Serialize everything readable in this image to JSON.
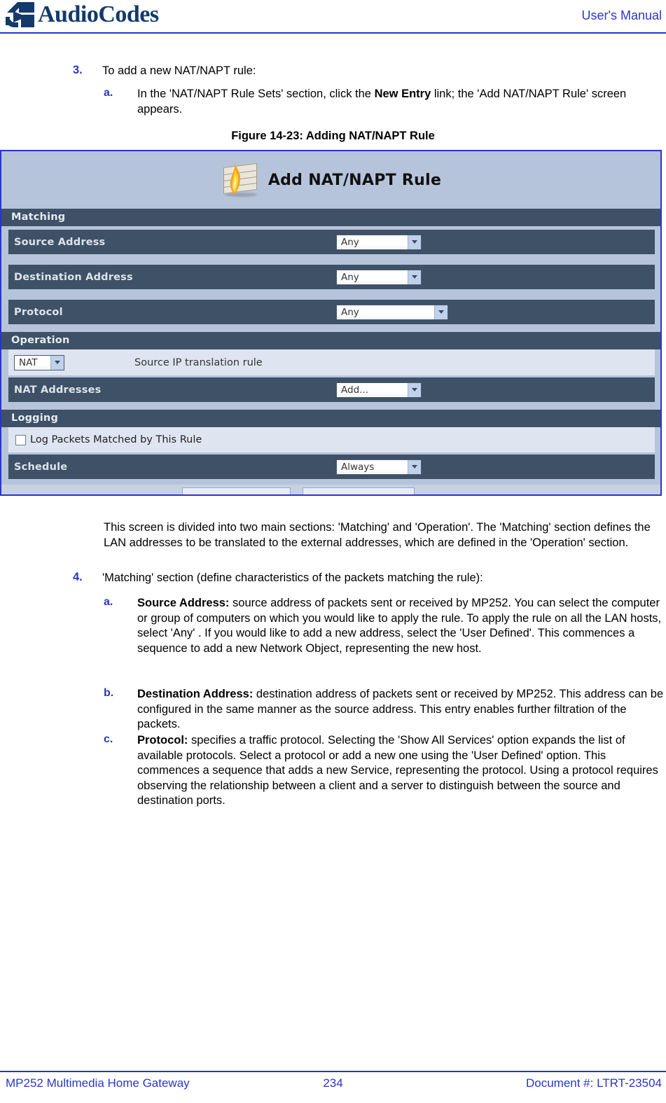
{
  "header": {
    "logo_text": "AudioCodes",
    "logo_icon": "audiocodes-logo-icon",
    "manual_label": "User's Manual"
  },
  "steps": {
    "step3_marker": "3.",
    "step3_text": "To add a new NAT/NAPT rule:",
    "step3a_marker": "a.",
    "step3a_text_part1": "In the 'NAT/NAPT Rule Sets' section, click the ",
    "step3a_bold": "New Entry",
    "step3a_text_part2": " link; the 'Add NAT/NAPT Rule' screen appears."
  },
  "figure": {
    "caption": "Figure 14-23: Adding NAT/NAPT Rule"
  },
  "screenshot": {
    "icon": "firewall-brick-flame-icon",
    "title": "Add NAT/NAPT Rule",
    "sections": [
      {
        "name": "Matching"
      },
      {
        "name": "Operation"
      },
      {
        "name": "Logging"
      }
    ],
    "matching_rows": [
      {
        "label": "Source Address",
        "value": "Any"
      },
      {
        "label": "Destination Address",
        "value": "Any"
      },
      {
        "label": "Protocol",
        "value": "Any"
      }
    ],
    "operation": {
      "select_value": "NAT",
      "description": "Source IP translation rule",
      "nat_addresses_label": "NAT Addresses",
      "nat_addresses_value": "Add..."
    },
    "logging": {
      "checkbox_label": "Log Packets Matched by This Rule",
      "checked": false
    },
    "schedule": {
      "label": "Schedule",
      "value": "Always"
    }
  },
  "body": {
    "para1": "This screen is divided into two main sections: 'Matching' and 'Operation'. The 'Matching' section defines the LAN addresses to be translated to the external addresses, which are defined in the 'Operation' section.",
    "step4_marker": "4.",
    "step4_text": "'Matching' section (define characteristics of the packets matching the rule):",
    "items": [
      {
        "marker": "a.",
        "bold": "Source Address:",
        "text": " source address of packets sent or received by MP252. You can select the computer or group of computers on which you would like to apply the rule. To apply the rule on all the LAN hosts, select 'Any' . If you would like to add a new address, select the 'User Defined'. This commences a sequence to add a new Network Object, representing the new host."
      },
      {
        "marker": "b.",
        "bold": "Destination Address:",
        "text": " destination address of packets sent or received by MP252. This address can be configured in the same manner as the source address. This entry enables further filtration of the packets."
      },
      {
        "marker": "c.",
        "bold": "Protocol:",
        "text": " specifies a traffic protocol. Selecting the 'Show All Services' option expands the list of available protocols. Select a protocol or add a new one using the 'User Defined' option. This commences a sequence that adds a new Service, representing the protocol. Using a protocol requires observing the relationship between a client and a server to distinguish between the source and destination ports."
      }
    ]
  },
  "footer": {
    "left": "MP252 Multimedia Home Gateway",
    "page": "234",
    "right": "Document #: LTRT-23504"
  },
  "colors": {
    "brand_blue": "#2B35C8",
    "logo_navy": "#123A6B",
    "row_dark": "#3E5166",
    "row_light": "#DEE5F1",
    "shot_bg": "#B6C4DB"
  }
}
